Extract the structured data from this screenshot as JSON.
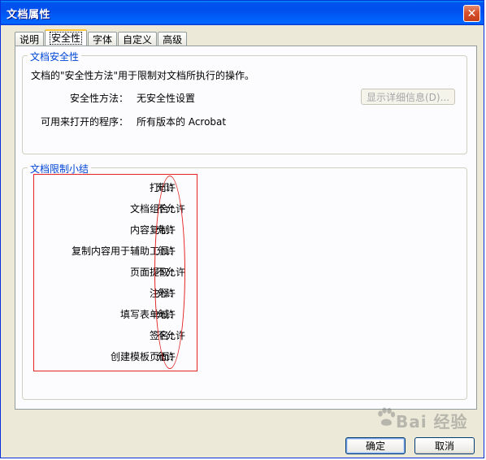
{
  "window": {
    "title": "文档属性",
    "close_glyph": "✕"
  },
  "tabs": [
    {
      "label": "说明",
      "active": false
    },
    {
      "label": "安全性",
      "active": true
    },
    {
      "label": "字体",
      "active": false
    },
    {
      "label": "自定义",
      "active": false
    },
    {
      "label": "高级",
      "active": false
    }
  ],
  "security": {
    "legend": "文档安全性",
    "description": "文档的\"安全性方法\"用于限制对文档所执行的操作。",
    "method_label": "安全性方法：",
    "method_value": "无安全性设置",
    "detail_button": "显示详细信息(D)...",
    "openable_label": "可用来打开的程序：",
    "openable_value": "所有版本的 Acrobat"
  },
  "summary": {
    "legend": "文档限制小结",
    "rows": [
      {
        "label": "打印：",
        "value": "允许"
      },
      {
        "label": "文档组合：",
        "value": "不允许"
      },
      {
        "label": "内容复制：",
        "value": "允许"
      },
      {
        "label": "复制内容用于辅助工具：",
        "value": "允许"
      },
      {
        "label": "页面提取：",
        "value": "不允许"
      },
      {
        "label": "注释：",
        "value": "允许"
      },
      {
        "label": "填写表单域：",
        "value": "允许"
      },
      {
        "label": "签名：",
        "value": "不允许"
      },
      {
        "label": "创建模板页面：",
        "value": "允许"
      }
    ]
  },
  "buttons": {
    "ok": "确定",
    "cancel": "取消"
  },
  "watermark": {
    "text": "Bai 经验",
    "icon": "paw-icon"
  },
  "colors": {
    "title_bar": "#0053ee",
    "legend": "#0046d5",
    "annotation": "#e52323",
    "face": "#ece9d8"
  }
}
